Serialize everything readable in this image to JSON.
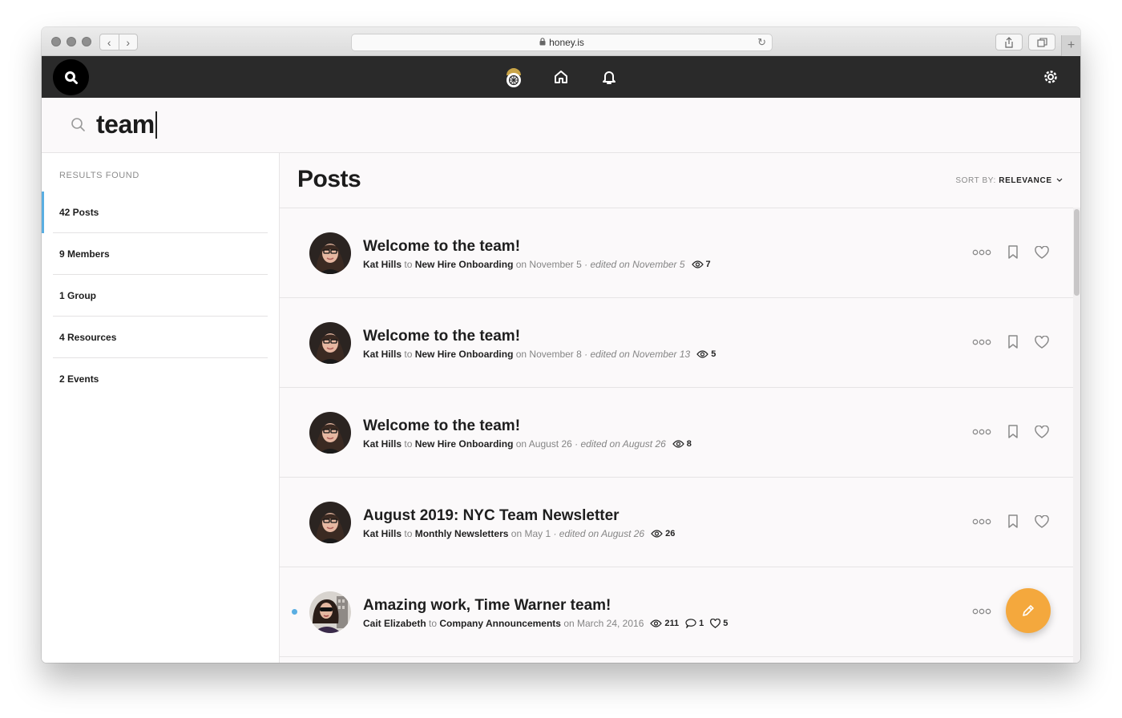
{
  "browser": {
    "url": "honey.is",
    "lock_icon": "lock-icon",
    "reload_icon": "reload-icon",
    "back_icon": "chevron-left-icon",
    "forward_icon": "chevron-right-icon",
    "new_tab_label": "+"
  },
  "topnav": {
    "search_icon": "search-icon",
    "logo_icon": "honey-logo-icon",
    "home_icon": "home-icon",
    "bell_icon": "bell-icon",
    "settings_icon": "gear-icon",
    "bg_color": "#2a2a2a"
  },
  "search": {
    "query": "team"
  },
  "sidebar": {
    "heading": "RESULTS FOUND",
    "items": [
      {
        "label": "42 Posts",
        "active": true
      },
      {
        "label": "9 Members",
        "active": false
      },
      {
        "label": "1 Group",
        "active": false
      },
      {
        "label": "4 Resources",
        "active": false
      },
      {
        "label": "2 Events",
        "active": false
      }
    ],
    "accent_color": "#5aaee2"
  },
  "main": {
    "title": "Posts",
    "sort_prefix": "SORT BY:",
    "sort_value": "RELEVANCE"
  },
  "posts": [
    {
      "title": "Welcome to the team!",
      "author": "Kat Hills",
      "to": "to",
      "group": "New Hire Onboarding",
      "on": "on November 5",
      "edited": "· edited on November 5",
      "views": "7",
      "comments": null,
      "likes": null,
      "unread": false
    },
    {
      "title": "Welcome to the team!",
      "author": "Kat Hills",
      "to": "to",
      "group": "New Hire Onboarding",
      "on": "on November 8",
      "edited": "· edited on November 13",
      "views": "5",
      "comments": null,
      "likes": null,
      "unread": false
    },
    {
      "title": "Welcome to the team!",
      "author": "Kat Hills",
      "to": "to",
      "group": "New Hire Onboarding",
      "on": "on August 26",
      "edited": "· edited on August 26",
      "views": "8",
      "comments": null,
      "likes": null,
      "unread": false
    },
    {
      "title": "August 2019: NYC Team Newsletter",
      "author": "Kat Hills",
      "to": "to",
      "group": "Monthly Newsletters",
      "on": "on May 1",
      "edited": "· edited on August 26",
      "views": "26",
      "comments": null,
      "likes": null,
      "unread": false
    },
    {
      "title": "Amazing work, Time Warner team!",
      "author": "Cait Elizabeth",
      "to": "to",
      "group": "Company Announcements",
      "on": "on March 24, 2016",
      "edited": "",
      "views": "211",
      "comments": "1",
      "likes": "5",
      "unread": true
    }
  ],
  "fab": {
    "icon": "pencil-icon",
    "color": "#f4a83d"
  }
}
